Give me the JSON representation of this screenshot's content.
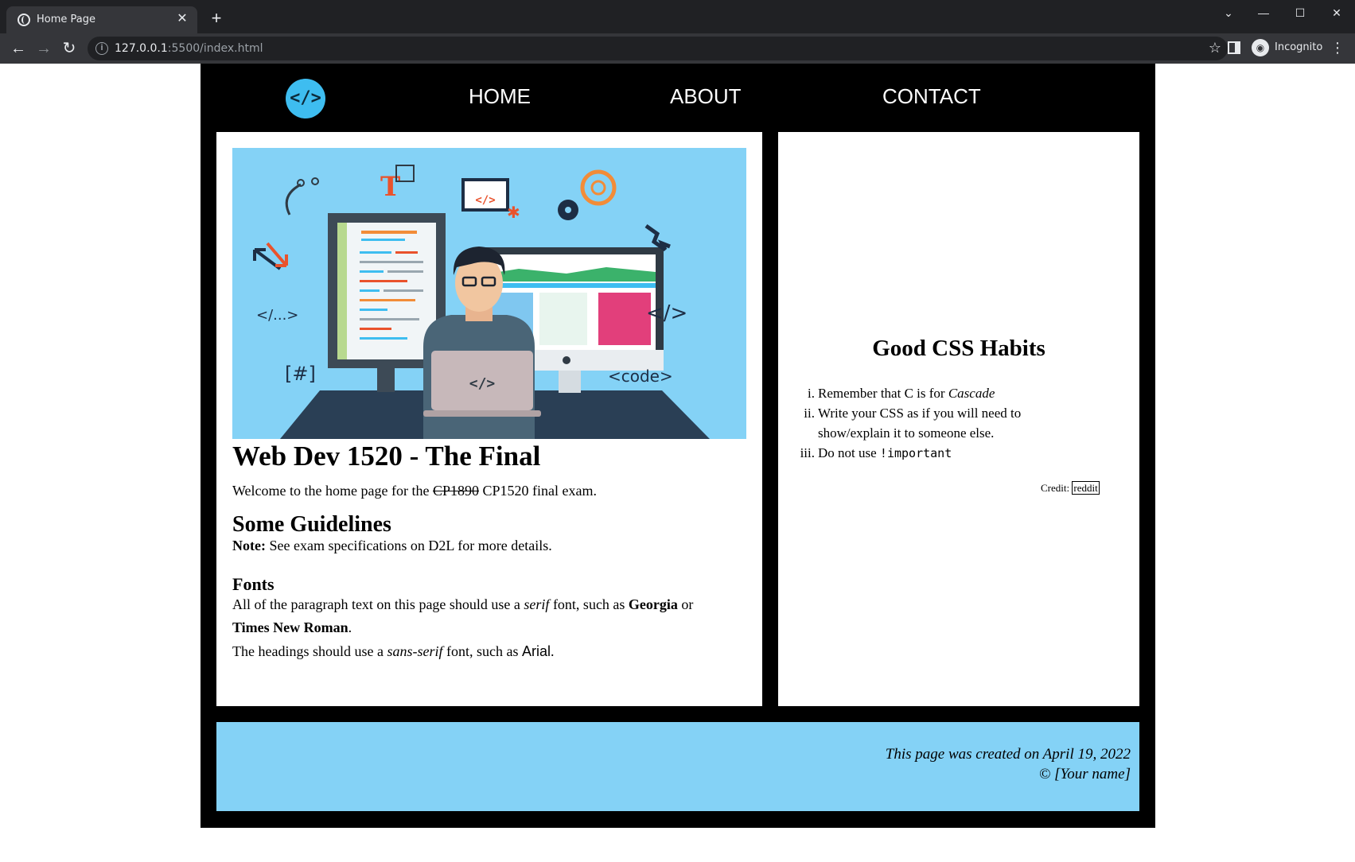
{
  "browser": {
    "tab_title": "Home Page",
    "new_tab_label": "+",
    "url_host": "127.0.0.1",
    "url_path": ":5500/index.html",
    "profile_label": "Incognito"
  },
  "nav": {
    "logo_text": "</>",
    "items": [
      "HOME",
      "ABOUT",
      "CONTACT"
    ]
  },
  "main": {
    "title": "Web Dev 1520 - The Final",
    "welcome_pre": "Welcome to the home page for the ",
    "welcome_struck": "CP1890",
    "welcome_post": " CP1520 final exam.",
    "guidelines_heading": "Some Guidelines",
    "note_label": "Note:",
    "note_text": " See exam specifications on D2L for more details.",
    "fonts_heading": "Fonts",
    "fonts_p1_a": "All of the paragraph text on this page should use a ",
    "fonts_p1_serif": "serif",
    "fonts_p1_b": " font, such as ",
    "fonts_p1_georgia": "Georgia",
    "fonts_p1_or": " or",
    "fonts_p1_tnr": "Times New Roman",
    "fonts_p1_end": ".",
    "fonts_p2_a": "The headings should use a ",
    "fonts_p2_sans": "sans-serif",
    "fonts_p2_b": " font, such as ",
    "fonts_p2_arial": "Arial",
    "fonts_p2_end": "."
  },
  "hero": {
    "labels": [
      "T",
      "</>",
      "</...>",
      "</>",
      "[#]",
      "<code>",
      "</>"
    ]
  },
  "side": {
    "title": "Good CSS Habits",
    "items": [
      {
        "num": "i.",
        "pre": "Remember that C is for ",
        "em": "Cascade"
      },
      {
        "num": "ii.",
        "pre": "Write your CSS as if you will need to show/explain it to someone else."
      },
      {
        "num": "iii.",
        "pre": "Do not use ",
        "code": "!important"
      }
    ],
    "credit_label": "Credit: ",
    "credit_link": "reddit"
  },
  "footer": {
    "line1": "This page was created on April 19, 2022",
    "line2": "© [Your name]"
  },
  "colors": {
    "page_bg": "#000000",
    "accent": "#84d2f6",
    "logo": "#3ebdf0"
  }
}
